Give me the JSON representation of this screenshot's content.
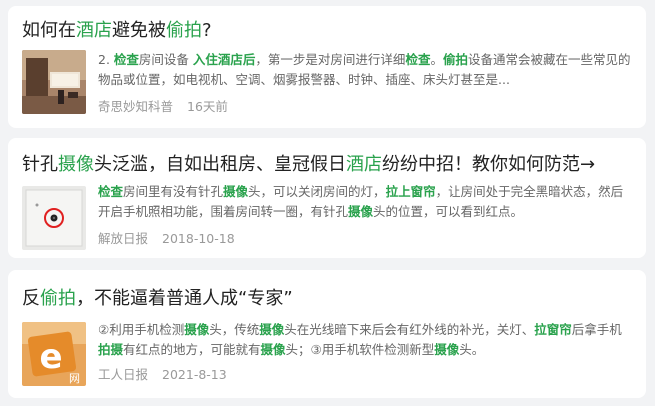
{
  "results": [
    {
      "title": [
        {
          "t": "如何在",
          "hl": false
        },
        {
          "t": "酒店",
          "hl": true
        },
        {
          "t": "避免被",
          "hl": false
        },
        {
          "t": "偷拍",
          "hl": true
        },
        {
          "t": "?",
          "hl": false
        }
      ],
      "snippet": [
        {
          "t": "2. ",
          "hl": false
        },
        {
          "t": "检查",
          "hl": true
        },
        {
          "t": "房间设备 ",
          "hl": false
        },
        {
          "t": "入住酒店后",
          "hl": true
        },
        {
          "t": "，第一步是对房间进行详细",
          "hl": false
        },
        {
          "t": "检查",
          "hl": true
        },
        {
          "t": "。",
          "hl": false
        },
        {
          "t": "偷拍",
          "hl": true
        },
        {
          "t": "设备通常会被藏在一些常见的物品或位置，如电视机、空调、烟雾报警器、时钟、插座、床头灯甚至是...",
          "hl": false
        }
      ],
      "source": "奇思妙知科普",
      "date": "16天前",
      "thumb_icon": "hotel-room-photo"
    },
    {
      "title": [
        {
          "t": "针孔",
          "hl": false
        },
        {
          "t": "摄像",
          "hl": true
        },
        {
          "t": "头泛滥，自如出租房、皇冠假日",
          "hl": false
        },
        {
          "t": "酒店",
          "hl": true
        },
        {
          "t": "纷纷中招！教你如何防范→",
          "hl": false
        }
      ],
      "snippet": [
        {
          "t": "检查",
          "hl": true
        },
        {
          "t": "房间里有没有针孔",
          "hl": false
        },
        {
          "t": "摄像",
          "hl": true
        },
        {
          "t": "头，可以关闭房间的灯，",
          "hl": false
        },
        {
          "t": "拉上窗帘",
          "hl": true
        },
        {
          "t": "，让房间处于完全黑暗状态，然后开启手机照相功能，围着房间转一圈，有针孔",
          "hl": false
        },
        {
          "t": "摄像",
          "hl": true
        },
        {
          "t": "头的位置，可以看到红点。",
          "hl": false
        }
      ],
      "source": "解放日报",
      "date": "2018-10-18",
      "thumb_icon": "pinhole-camera-photo"
    },
    {
      "title": [
        {
          "t": "反",
          "hl": false
        },
        {
          "t": "偷拍",
          "hl": true
        },
        {
          "t": "，不能逼着普通人成“专家”",
          "hl": false
        }
      ],
      "snippet": [
        {
          "t": "②利用手机检测",
          "hl": false
        },
        {
          "t": "摄像",
          "hl": true
        },
        {
          "t": "头，传统",
          "hl": false
        },
        {
          "t": "摄像",
          "hl": true
        },
        {
          "t": "头在光线暗下来后会有红外线的补光，关灯、",
          "hl": false
        },
        {
          "t": "拉窗帘",
          "hl": true
        },
        {
          "t": "后拿手机",
          "hl": false
        },
        {
          "t": "拍摄",
          "hl": true
        },
        {
          "t": "有红点的地方，可能就有",
          "hl": false
        },
        {
          "t": "摄像",
          "hl": true
        },
        {
          "t": "头；③用手机软件检测新型",
          "hl": false
        },
        {
          "t": "摄像",
          "hl": true
        },
        {
          "t": "头。",
          "hl": false
        }
      ],
      "source": "工人日报",
      "date": "2021-8-13",
      "thumb_icon": "e-logo-photo"
    }
  ],
  "thumb_text": "网"
}
